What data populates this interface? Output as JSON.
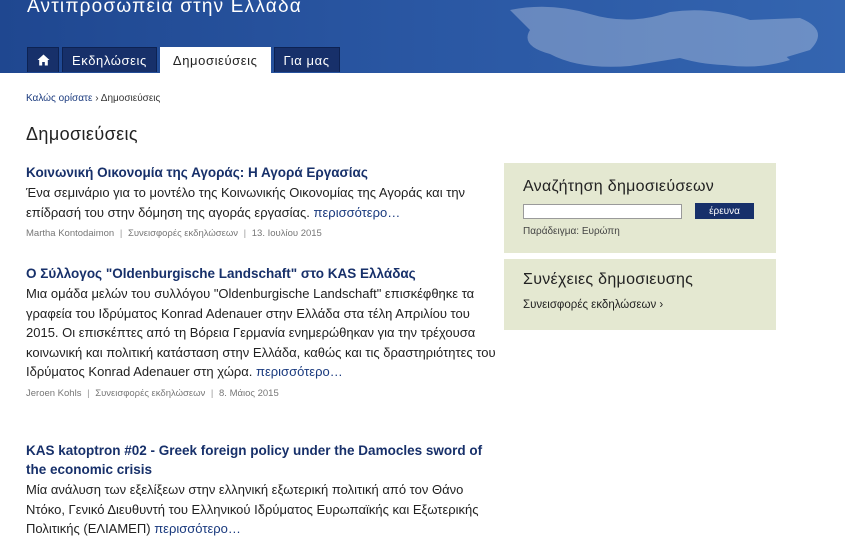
{
  "header": {
    "site_title": "Αντιπροσωπεία στην Ελλάδα"
  },
  "nav": {
    "home_icon": "home-icon",
    "items": [
      {
        "label": "Εκδηλώσεις"
      },
      {
        "label": "Δημοσιεύσεις"
      },
      {
        "label": "Για μας"
      }
    ],
    "active": "Δημοσιεύσεις"
  },
  "breadcrumb": {
    "home": "Καλώς ορίσατε",
    "separator": "›",
    "current": "Δημοσιεύσεις"
  },
  "page_title": "Δημοσιεύσεις",
  "articles": [
    {
      "title": "Κοινωνική Οικονομία της Αγοράς: Η Αγορά Εργασίας",
      "body": "Ένα σεμινάριο για το μοντέλο της Κοινωνικής Οικονομίας της Αγοράς και την επίδρασή του στην δόμηση της αγοράς εργασίας.",
      "more": "περισσότερο…",
      "author": "Martha Kontodaimon",
      "category": "Συνεισφορές εκδηλώσεων",
      "date": "13. Ιουλίου 2015"
    },
    {
      "title": "Ο Σύλλογος \"Oldenburgische Landschaft\" στο KAS Ελλάδας",
      "body": "Μια ομάδα μελών του συλλόγου \"Oldenburgische Landschaft\" επισκέφθηκε τα γραφεία του Ιδρύματος Konrad Adenauer στην Ελλάδα στα τέλη Απριλίου του 2015. Οι επισκέπτες από τη Βόρεια Γερμανία ενημερώθηκαν για την τρέχουσα κοινωνική και πολιτική κατάσταση στην Ελλάδα, καθώς και τις δραστηριότητες του Ιδρύματος Konrad Adenauer στη χώρα.",
      "more": "περισσότερο…",
      "author": "Jeroen Kohls",
      "category": "Συνεισφορές εκδηλώσεων",
      "date": "8. Μάιος 2015"
    },
    {
      "title": "KAS katoptron #02 - Greek foreign policy under the Damocles sword of the economic crisis",
      "body": "Μία ανάλυση των εξελίξεων στην ελληνική εξωτερική πολιτική από τον Θάνο Ντόκο, Γενικό Διευθυντή του Ελληνικού Ιδρύματος Ευρωπαϊκής και Εξωτερικής Πολιτικής (ΕΛΙΑΜΕΠ)",
      "more": "περισσότερο…"
    }
  ],
  "meta_separator": "|",
  "sidebar": {
    "search": {
      "title": "Αναζήτηση δημοσιεύσεων",
      "input_value": "",
      "button": "έρευνα",
      "example": "Παράδειγμα: Ευρώπη"
    },
    "series": {
      "title": "Συνέχειες δημοσιευσης",
      "link": "Συνεισφορές εκδηλώσεων ›"
    }
  },
  "colors": {
    "header_blue": "#2a57a3",
    "nav_dark": "#17306a",
    "sidebar_bg": "#e4e8d1",
    "link": "#17306a"
  }
}
